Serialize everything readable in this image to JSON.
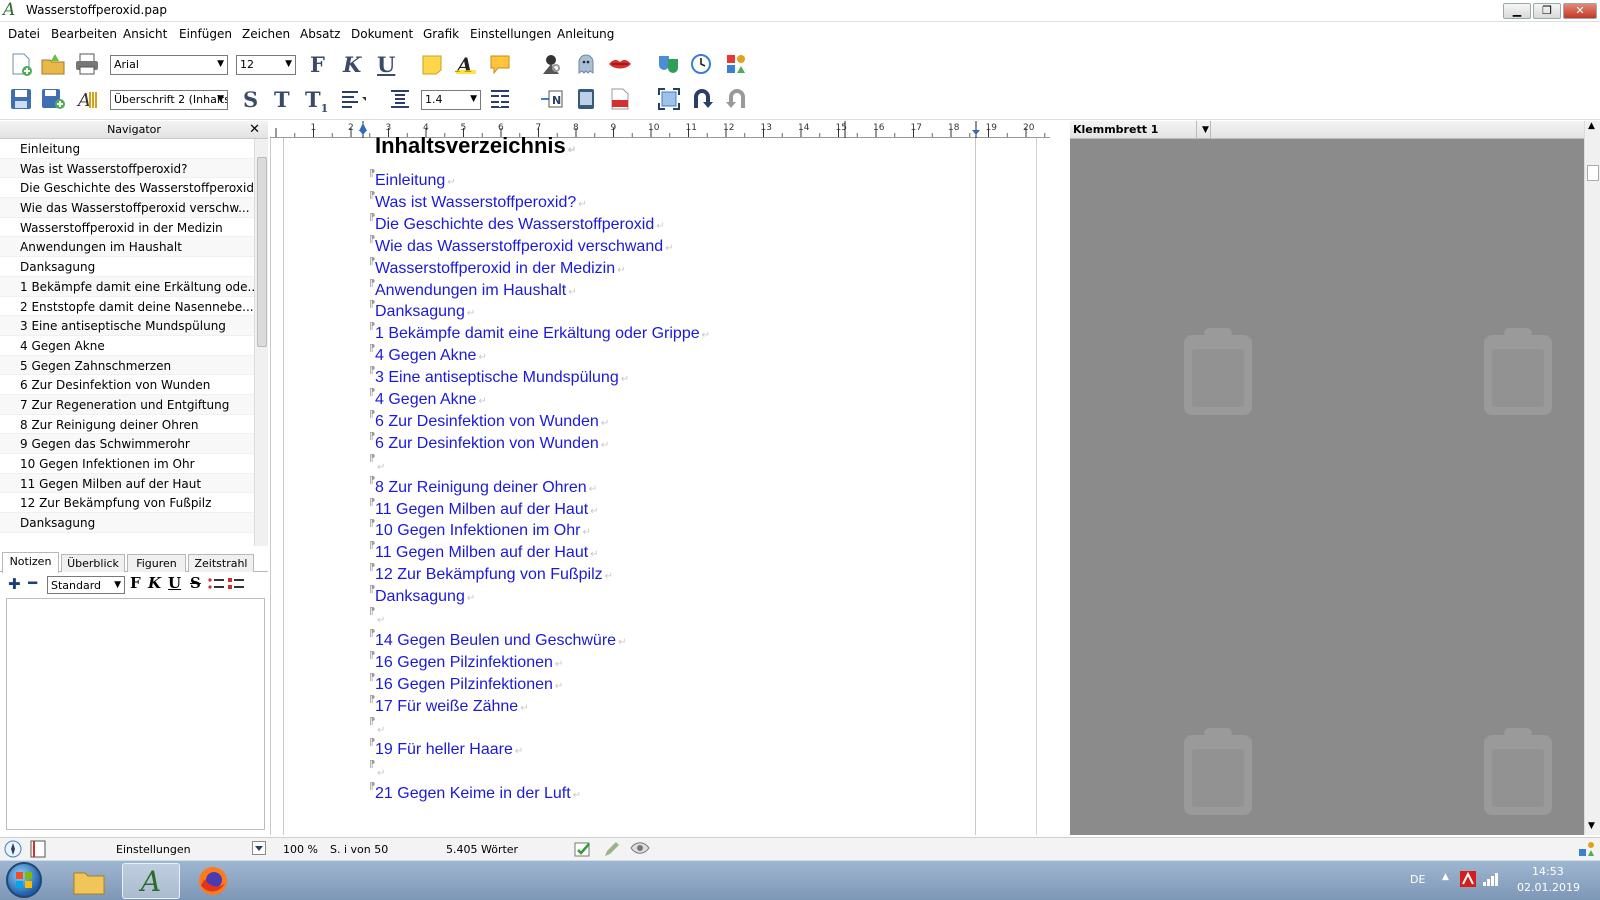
{
  "window": {
    "title": "Wasserstoffperoxid.pap",
    "minimize": "▁",
    "maximize": "❐",
    "close": "✕"
  },
  "menu": [
    "Datei",
    "Bearbeiten",
    "Ansicht",
    "Einfügen",
    "Zeichen",
    "Absatz",
    "Dokument",
    "Grafik",
    "Einstellungen",
    "Anleitung"
  ],
  "toolbar": {
    "font": "Arial",
    "size": "12",
    "style": "Überschrift 2 (Inhalts",
    "line_spacing": "1.4",
    "bold": "F",
    "italic": "K",
    "underline": "U",
    "strike": "S",
    "tt": "T",
    "sub": "T",
    "sub_small": "1"
  },
  "navigator": {
    "title": "Navigator",
    "close": "✕",
    "items": [
      "Einleitung",
      "Was ist Wasserstoffperoxid?",
      "Die Geschichte des Wasserstoffperoxid",
      "Wie das Wasserstoffperoxid verschw...",
      "Wasserstoffperoxid in der Medizin",
      "Anwendungen im Haushalt",
      "Danksagung",
      "1 Bekämpfe damit eine Erkältung ode...",
      "2 Enststopfe damit deine Nasennebe...",
      "3 Eine antiseptische Mundspülung",
      "4 Gegen Akne",
      "5 Gegen Zahnschmerzen",
      "6 Zur Desinfektion von Wunden",
      "7 Zur Regeneration und Entgiftung",
      "8 Zur Reinigung deiner Ohren",
      "9 Gegen das Schwimmerohr",
      "10 Gegen Infektionen im Ohr",
      "11 Gegen Milben auf der Haut",
      "12 Zur Bekämpfung von Fußpilz",
      "Danksagung"
    ]
  },
  "tabs": [
    "Notizen",
    "Überblick",
    "Figuren",
    "Zeitstrahl"
  ],
  "notes": {
    "style": "Standard",
    "bold": "F",
    "italic": "K",
    "underline": "U",
    "strike": "S"
  },
  "ruler": {
    "numbers": [
      "1",
      "2",
      "3",
      "4",
      "5",
      "6",
      "7",
      "8",
      "9",
      "10",
      "11",
      "12",
      "13",
      "14",
      "15",
      "16",
      "17",
      "18",
      "19",
      "20"
    ]
  },
  "document": {
    "heading": "Inhaltsverzeichnis",
    "entries": [
      "Einleitung",
      "Was ist Wasserstoffperoxid?",
      "Die Geschichte des Wasserstoffperoxid",
      "Wie das Wasserstoffperoxid verschwand",
      "Wasserstoffperoxid in der Medizin",
      "Anwendungen im Haushalt",
      "Danksagung",
      "1 Bekämpfe damit eine Erkältung oder Grippe",
      "4 Gegen Akne",
      "3 Eine antiseptische Mundspülung",
      "4 Gegen Akne",
      "6 Zur Desinfektion von Wunden",
      "6 Zur Desinfektion von Wunden",
      "",
      "8 Zur Reinigung deiner Ohren",
      "11 Gegen Milben auf der Haut",
      "10 Gegen Infektionen im Ohr",
      "11 Gegen Milben auf der Haut",
      "12 Zur Bekämpfung von Fußpilz",
      "Danksagung",
      "",
      "14 Gegen Beulen und Geschwüre",
      "16 Gegen Pilzinfektionen",
      "16 Gegen Pilzinfektionen",
      "17 Für weiße Zähne",
      "",
      "19 Für heller Haare",
      "",
      "21 Gegen Keime in der Luft"
    ],
    "return_mark": "↵",
    "para_mark": "⁋"
  },
  "clipboard": {
    "title": "Klemmbrett 1"
  },
  "status": {
    "settings": "Einstellungen",
    "zoom": "100 %",
    "page": "S. i von 50",
    "words": "5.405 Wörter"
  },
  "taskbar": {
    "lang": "DE",
    "time": "14:53",
    "date": "02.01.2019"
  }
}
